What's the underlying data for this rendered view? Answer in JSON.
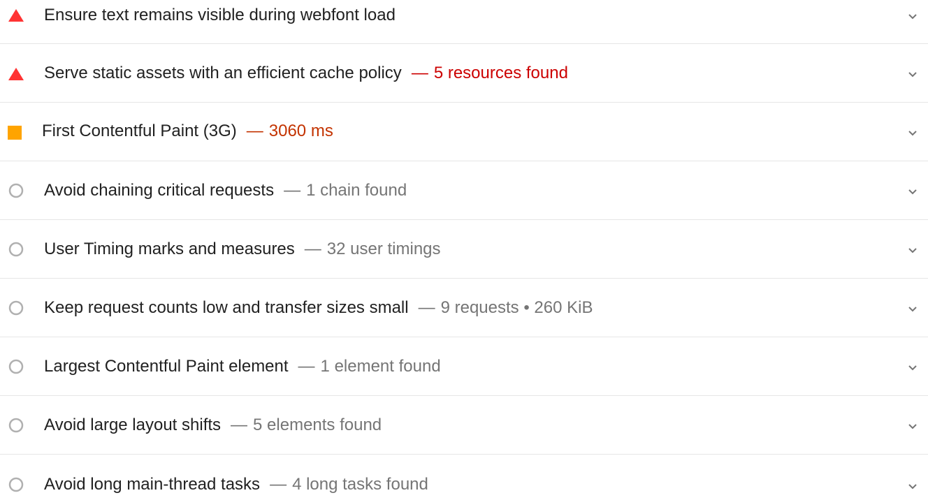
{
  "audits": [
    {
      "status": "fail",
      "title": "Ensure text remains visible during webfont load",
      "dash": "",
      "display_value": ""
    },
    {
      "status": "fail",
      "title": "Serve static assets with an efficient cache policy",
      "dash": "—",
      "display_value": "5 resources found"
    },
    {
      "status": "average",
      "title": "First Contentful Paint (3G)",
      "dash": "—",
      "display_value": "3060 ms"
    },
    {
      "status": "informative",
      "title": "Avoid chaining critical requests",
      "dash": "—",
      "display_value": "1 chain found"
    },
    {
      "status": "informative",
      "title": "User Timing marks and measures",
      "dash": "—",
      "display_value": "32 user timings"
    },
    {
      "status": "informative",
      "title": "Keep request counts low and transfer sizes small",
      "dash": "—",
      "display_value": "9 requests • 260 KiB"
    },
    {
      "status": "informative",
      "title": "Largest Contentful Paint element",
      "dash": "—",
      "display_value": "1 element found"
    },
    {
      "status": "informative",
      "title": "Avoid large layout shifts",
      "dash": "—",
      "display_value": "5 elements found"
    },
    {
      "status": "informative",
      "title": "Avoid long main-thread tasks",
      "dash": "—",
      "display_value": "4 long tasks found"
    }
  ],
  "icons": {
    "fail": "fail-triangle-icon",
    "average": "average-square-icon",
    "informative": "informative-circle-icon",
    "expand": "chevron-down-icon"
  },
  "colors": {
    "fail": "#ff3333",
    "average": "#ffa400",
    "informative": "#b0b0b0",
    "fail_text": "#cc0000",
    "average_text": "#c33300",
    "muted_text": "#757575",
    "chevron": "#757575"
  }
}
